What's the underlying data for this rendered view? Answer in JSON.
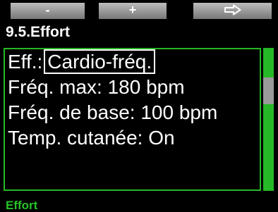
{
  "softkeys": {
    "minus_label": "-",
    "plus_label": "+",
    "next_icon": "right-arrow-outline-icon"
  },
  "page_title": "9.5.Effort",
  "settings": [
    {
      "label": "Eff.:",
      "value": "Cardio-fréq.",
      "selected": true
    },
    {
      "text": "Fréq. max: 180 bpm"
    },
    {
      "text": "Fréq. de base: 100 bpm"
    },
    {
      "text": "Temp. cutanée: On"
    }
  ],
  "footer_label": "Effort",
  "colors": {
    "background": "#000000",
    "accent_green": "#26b826",
    "text": "#ffffff",
    "scroll_thumb": "#9a9a9a"
  }
}
